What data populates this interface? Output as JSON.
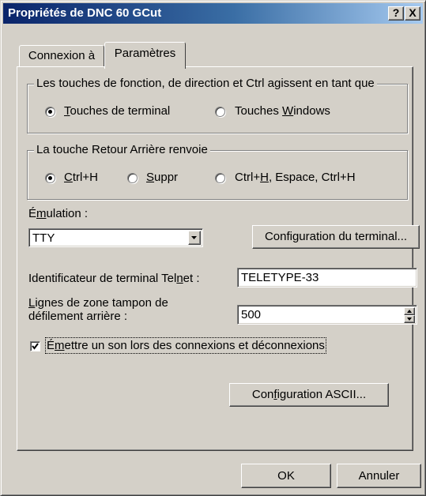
{
  "window": {
    "title": "Propriétés de DNC 60 GCut",
    "help_button": "?",
    "close_button": "X"
  },
  "tabs": [
    {
      "label": "Connexion à",
      "active": false
    },
    {
      "label": "Paramètres",
      "active": true
    }
  ],
  "keys_group": {
    "legend": "Les touches de fonction, de direction et Ctrl agissent en tant que",
    "options": [
      {
        "pre": "",
        "mnemonic": "T",
        "post": "ouches de terminal",
        "selected": true
      },
      {
        "pre": "Touches ",
        "mnemonic": "W",
        "post": "indows",
        "selected": false
      }
    ]
  },
  "backspace_group": {
    "legend": "La touche Retour Arrière renvoie",
    "options": [
      {
        "pre": "",
        "mnemonic": "C",
        "post": "trl+H",
        "selected": true
      },
      {
        "pre": "",
        "mnemonic": "S",
        "post": "uppr",
        "selected": false
      },
      {
        "pre": "Ctrl+",
        "mnemonic": "H",
        "post": ", Espace, Ctrl+H",
        "selected": false
      }
    ]
  },
  "emulation": {
    "label_pre": "É",
    "label_mnemonic": "m",
    "label_post": "ulation :",
    "value": "TTY",
    "terminal_config_button": "Configuration du terminal..."
  },
  "telnet_id": {
    "label_pre": "Identificateur de terminal Tel",
    "label_mnemonic": "n",
    "label_post": "et :",
    "value": "TELETYPE-33"
  },
  "scrollback": {
    "label_line1_mnemonic": "L",
    "label_line1_post": "ignes de zone tampon de",
    "label_line2": "défilement arrière :",
    "value": "500"
  },
  "sound_checkbox": {
    "checked": true,
    "label_pre": "É",
    "label_mnemonic": "m",
    "label_post": "ettre un son lors des connexions et déconnexions"
  },
  "ascii_button": {
    "pre": "Con",
    "mnemonic": "f",
    "post": "iguration ASCII..."
  },
  "footer": {
    "ok_label": "OK",
    "cancel_label": "Annuler"
  }
}
